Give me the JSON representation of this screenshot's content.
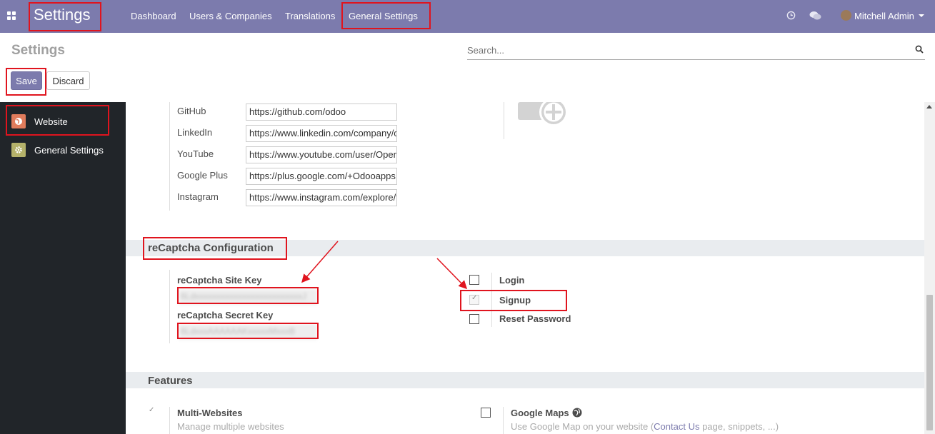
{
  "navbar": {
    "app_title": "Settings",
    "menu": [
      "Dashboard",
      "Users & Companies",
      "Translations",
      "General Settings"
    ],
    "user_name": "Mitchell Admin"
  },
  "control_panel": {
    "breadcrumb": "Settings",
    "search_placeholder": "Search...",
    "save_label": "Save",
    "discard_label": "Discard"
  },
  "sidebar": {
    "items": [
      {
        "label": "Website",
        "icon": "globe-icon",
        "color": "#e17c5c"
      },
      {
        "label": "General Settings",
        "icon": "gear-icon",
        "color": "#b5b26a"
      }
    ]
  },
  "social": {
    "rows": [
      {
        "label": "GitHub",
        "value": "https://github.com/odoo"
      },
      {
        "label": "LinkedIn",
        "value": "https://www.linkedin.com/company/odoo"
      },
      {
        "label": "YouTube",
        "value": "https://www.youtube.com/user/OpenERPonline"
      },
      {
        "label": "Google Plus",
        "value": "https://plus.google.com/+Odooapps"
      },
      {
        "label": "Instagram",
        "value": "https://www.instagram.com/explore/tags/odoo/"
      }
    ]
  },
  "recaptcha": {
    "section_title": "reCaptcha Configuration",
    "site_key_label": "reCaptcha Site Key",
    "site_key_value": "6LdxxxxxxxxxxxxxxxxxxxxxxxxxJ",
    "secret_key_label": "reCaptcha Secret Key",
    "secret_key_value": "6LdxxxAAAAAAKxxxxxMxxxB",
    "options": [
      {
        "label": "Login",
        "checked": false
      },
      {
        "label": "Signup",
        "checked": true
      },
      {
        "label": "Reset Password",
        "checked": false
      }
    ]
  },
  "features": {
    "section_title": "Features",
    "multi_websites": {
      "title": "Multi-Websites",
      "desc": "Manage multiple websites",
      "checked": true
    },
    "google_maps": {
      "title": "Google Maps",
      "desc_prefix": "Use Google Map on your website (",
      "link": "Contact Us",
      "desc_suffix": " page, snippets, ...)",
      "checked": false
    }
  },
  "colors": {
    "brand": "#7c7bad",
    "highlight": "#e0141e"
  }
}
